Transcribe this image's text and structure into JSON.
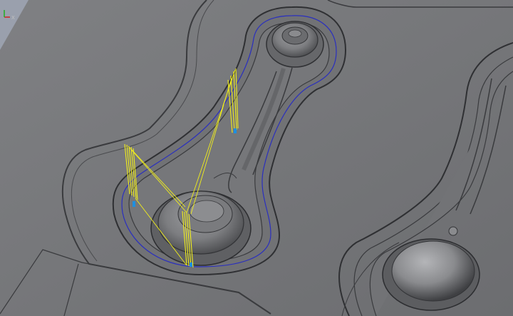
{
  "viewport": {
    "kind": "cad-3d-viewport",
    "background_color": "#6e6f71",
    "surface_color": "#7a7b7e",
    "toolpath_color": "#f2ef1a",
    "boundary_color": "#2a2fbf",
    "highlight_color": "#1e8fe0"
  },
  "triad": {
    "x_label": "X",
    "x_color": "#d02020",
    "y_color": "#20b020"
  }
}
